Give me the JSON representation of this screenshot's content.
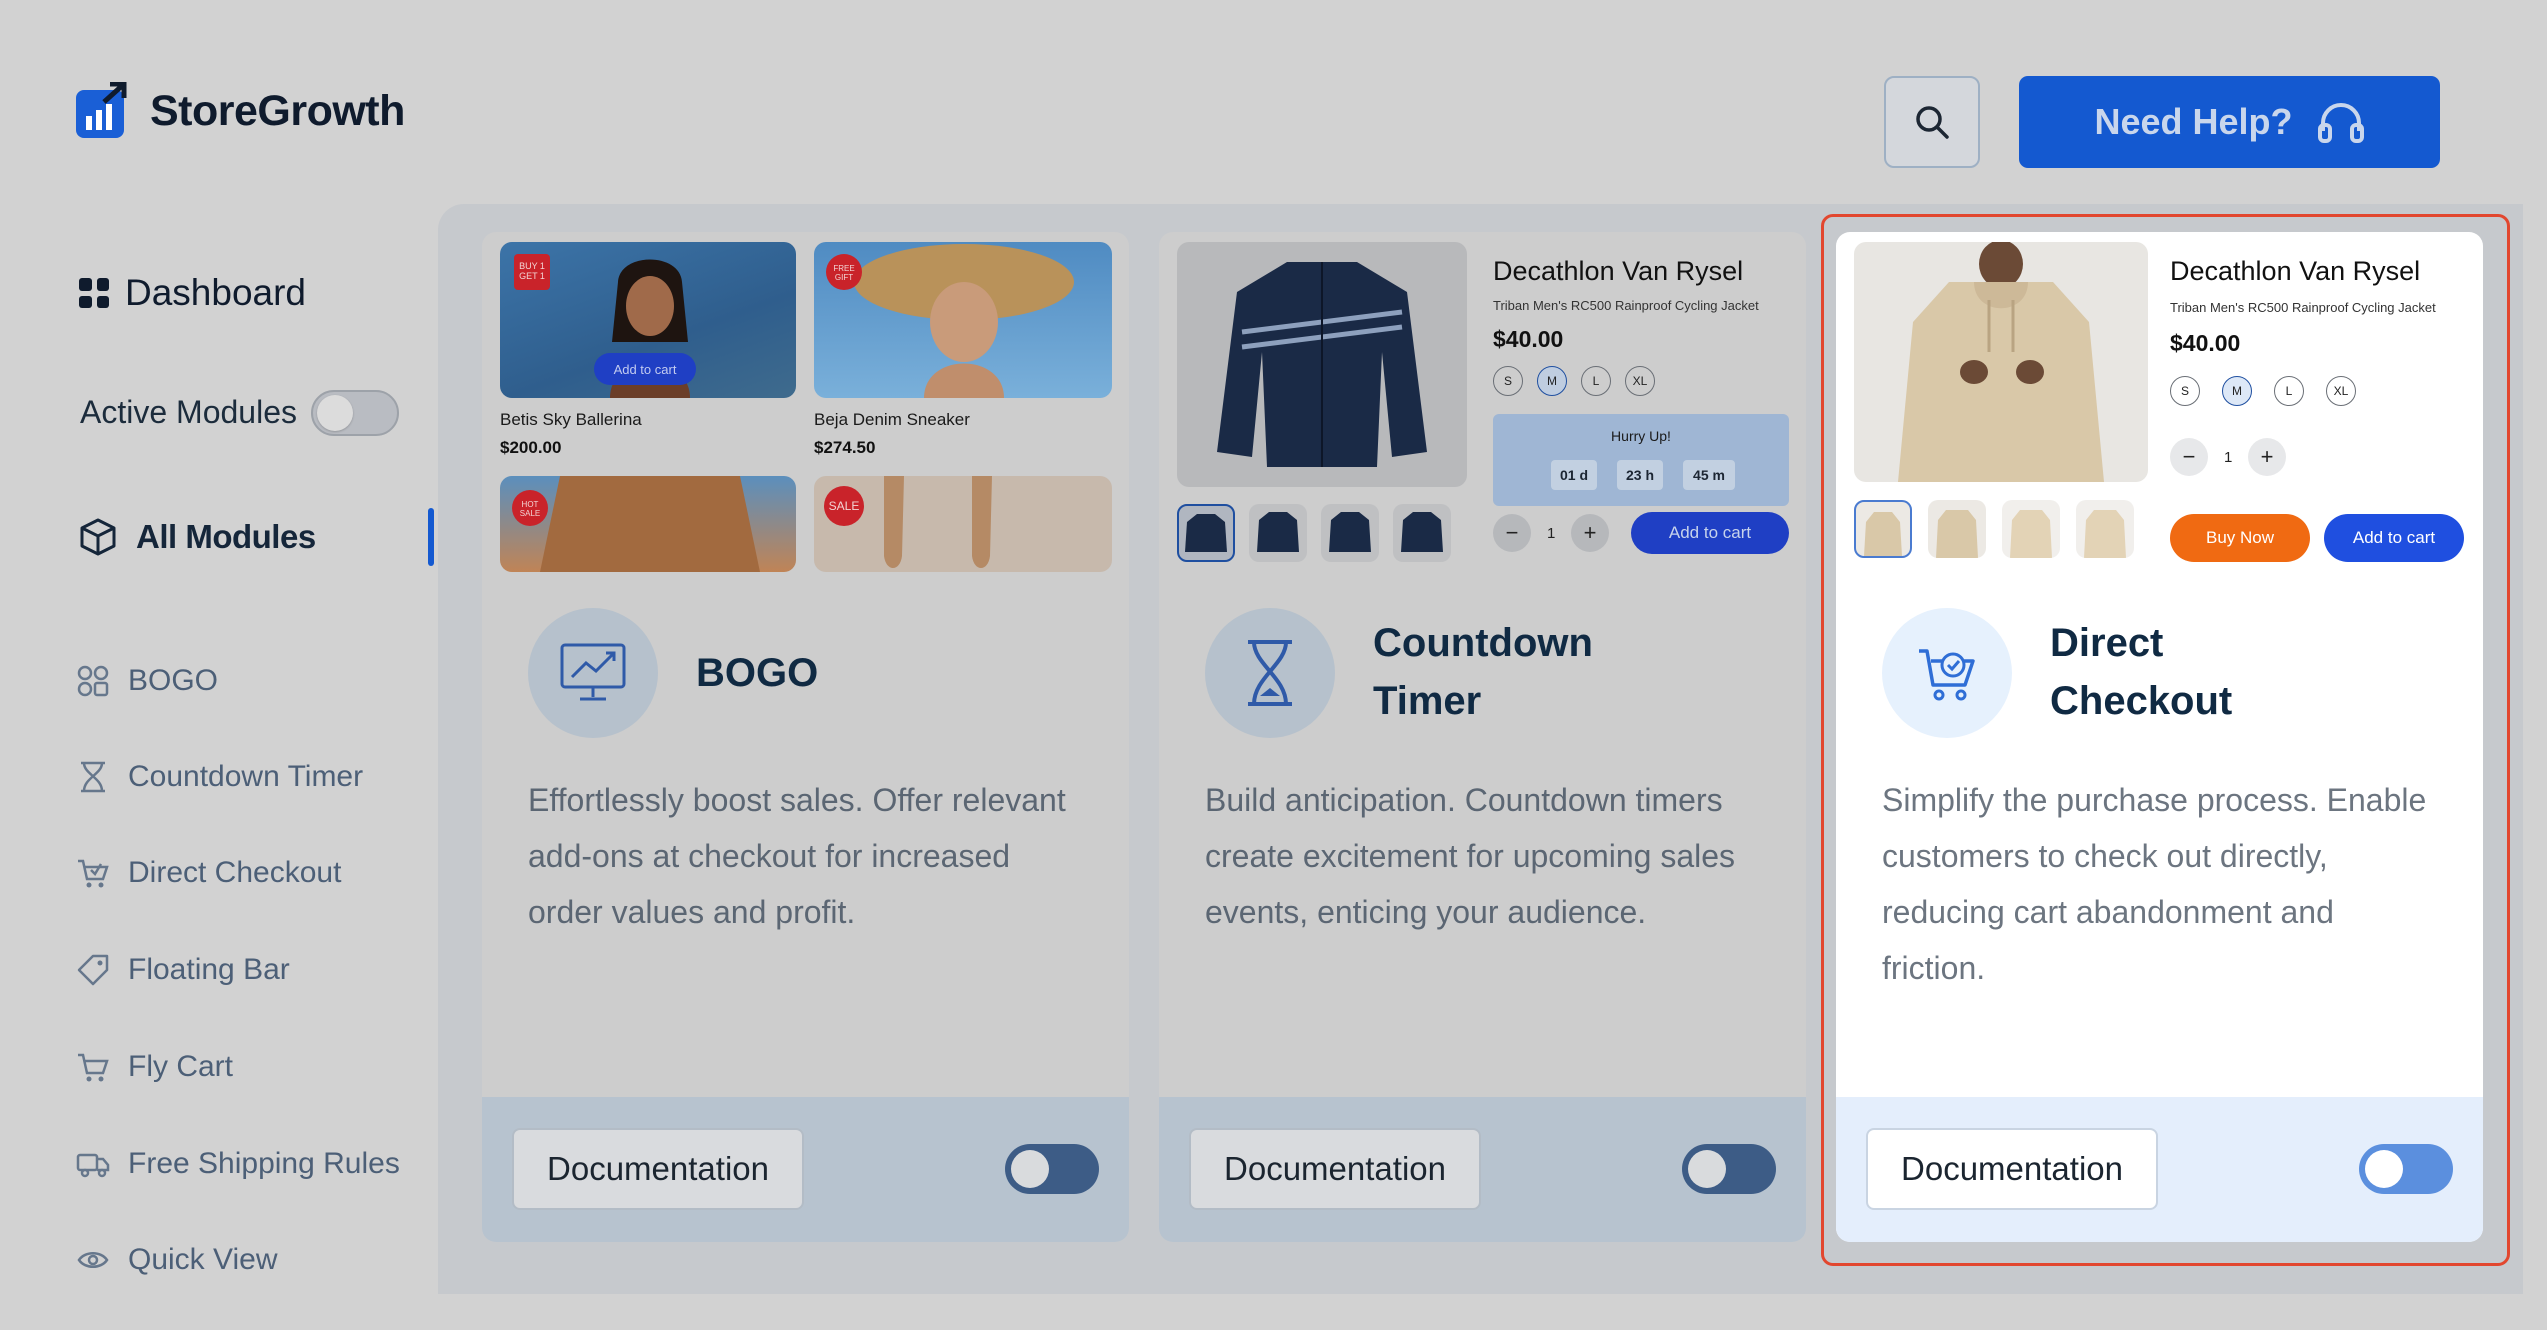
{
  "header": {
    "brand": "StoreGrowth",
    "help_label": "Need Help?"
  },
  "sidebar": {
    "dashboard_label": "Dashboard",
    "active_modules_label": "Active Modules",
    "all_modules_label": "All Modules",
    "items": [
      {
        "label": "BOGO",
        "icon": "bogo-icon"
      },
      {
        "label": "Countdown Timer",
        "icon": "hourglass-icon"
      },
      {
        "label": "Direct Checkout",
        "icon": "cart-check-icon"
      },
      {
        "label": "Floating Bar",
        "icon": "tag-icon"
      },
      {
        "label": "Fly Cart",
        "icon": "cart-icon"
      },
      {
        "label": "Free Shipping Rules",
        "icon": "truck-icon"
      },
      {
        "label": "Quick View",
        "icon": "eye-icon"
      }
    ]
  },
  "cards": [
    {
      "title_line1": "BOGO",
      "title_line2": "",
      "description": "Effortlessly boost sales. Offer relevant add-ons at checkout for increased order values and profit.",
      "doc_label": "Documentation",
      "preview": {
        "badge1": "BUY 1 GET 1",
        "badge2": "FREE GIFT",
        "badge3": "HOT SALE",
        "badge4": "SALE",
        "add_to_cart": "Add to cart",
        "product1_name": "Betis Sky Ballerina",
        "product1_price": "$200.00",
        "product2_name": "Beja Denim Sneaker",
        "product2_price": "$274.50"
      }
    },
    {
      "title_line1": "Countdown",
      "title_line2": "Timer",
      "description": "Build anticipation. Countdown timers create excitement for upcoming sales events, enticing your audience.",
      "doc_label": "Documentation",
      "preview": {
        "name": "Decathlon Van Rysel",
        "subtitle": "Triban Men's RC500 Rainproof Cycling Jacket",
        "price": "$40.00",
        "sizes": [
          "S",
          "M",
          "L",
          "XL"
        ],
        "hurry": "Hurry Up!",
        "timer": [
          "01 d",
          "23 h",
          "45 m"
        ],
        "qty": "1",
        "add_to_cart": "Add to cart"
      }
    },
    {
      "title_line1": "Direct",
      "title_line2": "Checkout",
      "description": "Simplify the purchase process. Enable customers to check out directly, reducing cart abandonment and friction.",
      "doc_label": "Documentation",
      "preview": {
        "name": "Decathlon Van Rysel",
        "subtitle": "Triban Men's RC500 Rainproof Cycling Jacket",
        "price": "$40.00",
        "sizes": [
          "S",
          "M",
          "L",
          "XL"
        ],
        "qty": "1",
        "buy_now": "Buy Now",
        "add_to_cart": "Add to cart"
      }
    }
  ],
  "colors": {
    "accent": "#1459d0",
    "highlight": "#e2472f",
    "buy_now": "#f06a12"
  }
}
